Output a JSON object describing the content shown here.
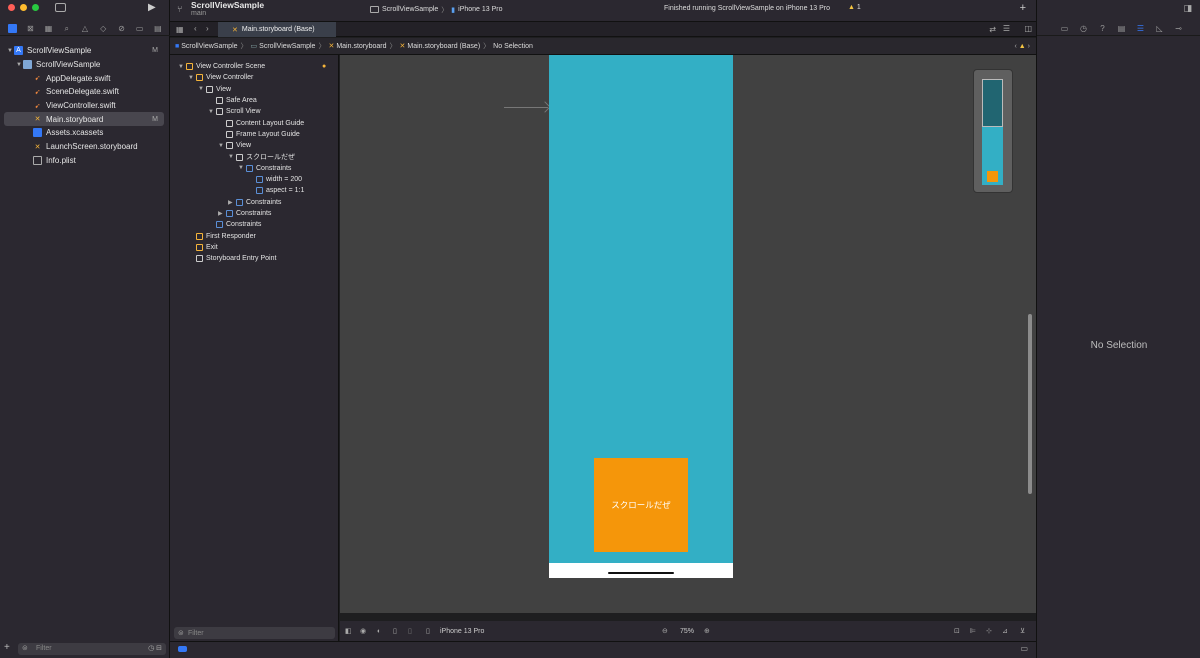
{
  "window": {
    "project_title": "ScrollViewSample",
    "branch": "main",
    "scheme": "ScrollViewSample",
    "device": "iPhone 13 Pro",
    "activity": "Finished running ScrollViewSample on iPhone 13 Pro",
    "warnings_count": "1"
  },
  "colors": {
    "accent": "#3478f6",
    "phone_background": "#33afc5",
    "orange_box": "#f5960a",
    "canvas": "#414141"
  },
  "navigator": {
    "files": [
      {
        "name": "ScrollViewSample",
        "icon": "project-icon",
        "badge": "M"
      },
      {
        "name": "ScrollViewSample",
        "icon": "folder-icon"
      },
      {
        "name": "AppDelegate.swift",
        "icon": "swift-icon"
      },
      {
        "name": "SceneDelegate.swift",
        "icon": "swift-icon"
      },
      {
        "name": "ViewController.swift",
        "icon": "swift-icon"
      },
      {
        "name": "Main.storyboard",
        "icon": "storyboard-icon",
        "badge": "M",
        "selected": true
      },
      {
        "name": "Assets.xcassets",
        "icon": "assets-icon"
      },
      {
        "name": "LaunchScreen.storyboard",
        "icon": "storyboard-icon"
      },
      {
        "name": "Info.plist",
        "icon": "plist-icon"
      }
    ],
    "filter_placeholder": "Filter"
  },
  "editor": {
    "tab_label": "Main.storyboard (Base)",
    "breadcrumb": [
      "ScrollViewSample",
      "ScrollViewSample",
      "Main.storyboard",
      "Main.storyboard (Base)",
      "No Selection"
    ]
  },
  "outline": {
    "items": [
      {
        "label": "View Controller Scene",
        "level": 0
      },
      {
        "label": "View Controller",
        "level": 1
      },
      {
        "label": "View",
        "level": 2
      },
      {
        "label": "Safe Area",
        "level": 3
      },
      {
        "label": "Scroll View",
        "level": 3
      },
      {
        "label": "Content Layout Guide",
        "level": 4
      },
      {
        "label": "Frame Layout Guide",
        "level": 4
      },
      {
        "label": "View",
        "level": 4
      },
      {
        "label": "スクロールだぜ",
        "level": 5
      },
      {
        "label": "Constraints",
        "level": 6
      },
      {
        "label": "width = 200",
        "level": 7
      },
      {
        "label": "aspect = 1:1",
        "level": 7
      },
      {
        "label": "Constraints",
        "level": 5
      },
      {
        "label": "Constraints",
        "level": 4
      },
      {
        "label": "Constraints",
        "level": 3
      },
      {
        "label": "First Responder",
        "level": 1
      },
      {
        "label": "Exit",
        "level": 1
      },
      {
        "label": "Storyboard Entry Point",
        "level": 1
      }
    ],
    "filter_placeholder": "Filter"
  },
  "canvas": {
    "box_label": "スクロールだぜ",
    "device_label": "iPhone 13 Pro",
    "zoom": "75%"
  },
  "inspector": {
    "empty_label": "No Selection"
  }
}
